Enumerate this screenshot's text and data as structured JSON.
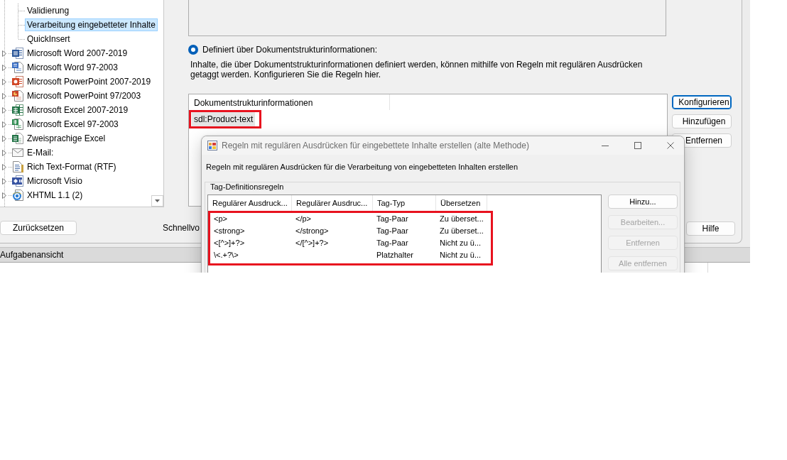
{
  "tree": {
    "items": [
      {
        "kind": "group",
        "children": [
          {
            "label": "Validierung",
            "selected": false
          },
          {
            "label": "Verarbeitung eingebetteter Inhalte",
            "selected": true
          },
          {
            "label": "QuickInsert",
            "selected": false
          }
        ]
      },
      {
        "kind": "docx",
        "label": "Microsoft Word 2007-2019",
        "expanded": false,
        "selected": false
      },
      {
        "kind": "doc",
        "label": "Microsoft Word 97-2003",
        "expanded": false,
        "selected": false
      },
      {
        "kind": "pptx",
        "label": "Microsoft PowerPoint 2007-2019",
        "expanded": false,
        "selected": false
      },
      {
        "kind": "ppt",
        "label": "Microsoft PowerPoint 97/2003",
        "expanded": false,
        "selected": false
      },
      {
        "kind": "xlsx",
        "label": "Microsoft Excel 2007-2019",
        "expanded": false,
        "selected": false
      },
      {
        "kind": "xls",
        "label": "Microsoft Excel 97-2003",
        "expanded": false,
        "selected": false
      },
      {
        "kind": "bilingual",
        "label": "Zweisprachige Excel",
        "expanded": false,
        "selected": false
      },
      {
        "kind": "email",
        "label": "E-Mail:",
        "expanded": false,
        "selected": false
      },
      {
        "kind": "rtf",
        "label": "Rich Text-Format (RTF)",
        "expanded": false,
        "selected": false
      },
      {
        "kind": "visio",
        "label": "Microsoft Visio",
        "expanded": false,
        "selected": false
      },
      {
        "kind": "xhtml",
        "label": "XHTML 1.1 (2)",
        "expanded": false,
        "selected": false
      }
    ]
  },
  "settings": {
    "option": {
      "label": "Definiert über Dokumentstrukturinformationen:",
      "selected": true
    },
    "description": "Inhalte, die über Dokumentstrukturinformationen definiert werden, können mithilfe von Regeln mit regulären Ausdrücken getaggt werden. Konfigurieren Sie die Regeln hier.",
    "structure_list": {
      "columns": [
        "Dokumentstrukturinformationen"
      ],
      "rows": [
        {
          "value": "sdl:Product-text",
          "selected": true,
          "highlighted": true
        }
      ]
    },
    "buttons": [
      {
        "label": "Konfigurieren",
        "focused": true
      },
      {
        "label": "Hinzufügen",
        "focused": false
      },
      {
        "label": "Entfernen",
        "focused": false
      }
    ]
  },
  "footer": {
    "reset_button": "Zurücksetzen",
    "cut_label": "Schnellvo",
    "help_button": "Hilfe"
  },
  "task_view": {
    "title": "Aufgabenansicht"
  },
  "dialog": {
    "title": "Regeln mit regulären Ausdrücken für eingebettete Inhalte erstellen (alte Methode)",
    "description": "Regeln mit regulären Ausdrücken für die Verarbeitung von eingebetteten Inhalten erstellen",
    "group_title": "Tag-Definitionsregeln",
    "table": {
      "columns": [
        "Regulärer Ausdruck...",
        "Regulärer Ausdruc...",
        "Tag-Typ",
        "Übersetzen"
      ],
      "highlighted": true,
      "rows": [
        {
          "start": "<p>",
          "end": "</p>",
          "tag_type": "Tag-Paar",
          "translate": "Zu überset..."
        },
        {
          "start": "<strong>",
          "end": "</strong>",
          "tag_type": "Tag-Paar",
          "translate": "Zu überset..."
        },
        {
          "start": "<[^>]+?>",
          "end": "</[^>]+?>",
          "tag_type": "Tag-Paar",
          "translate": "Nicht zu ü..."
        },
        {
          "start": "\\<.+?\\>",
          "tag_type": "Platzhalter",
          "translate": "Nicht zu ü..."
        }
      ]
    },
    "buttons": [
      {
        "label": "Hinzu...",
        "disabled": false
      },
      {
        "label": "Bearbeiten...",
        "disabled": true
      },
      {
        "label": "Entfernen",
        "disabled": true
      },
      {
        "label": "Alle entfernen",
        "disabled": true
      }
    ]
  }
}
